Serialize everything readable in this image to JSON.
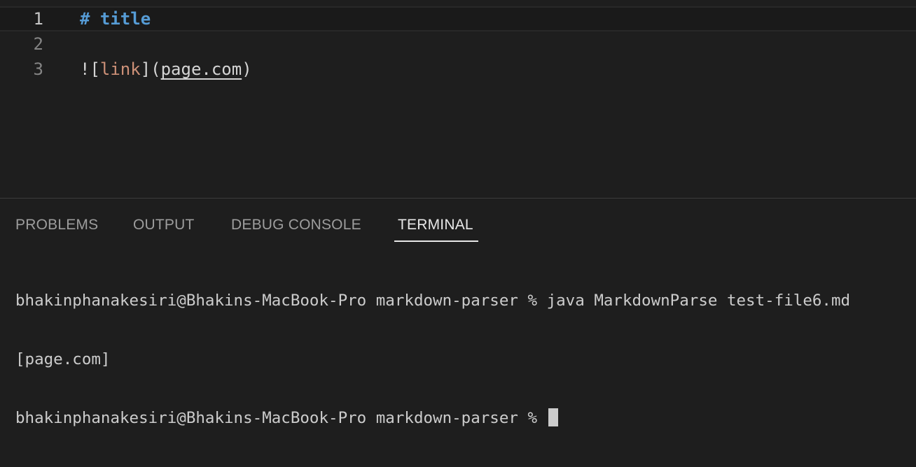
{
  "editor": {
    "lines": [
      {
        "number": "1",
        "parts": {
          "heading": "# title"
        }
      },
      {
        "number": "2"
      },
      {
        "number": "3",
        "parts": {
          "bang_open": "![",
          "link_text": "link",
          "bracket_paren": "](",
          "url": "page.com",
          "close": ")"
        }
      }
    ]
  },
  "panel": {
    "tabs": [
      {
        "label": "PROBLEMS"
      },
      {
        "label": "OUTPUT"
      },
      {
        "label": "DEBUG CONSOLE"
      },
      {
        "label": "TERMINAL",
        "active": true
      }
    ],
    "terminal": {
      "lines": [
        "bhakinphanakesiri@Bhakins-MacBook-Pro markdown-parser % java MarkdownParse test-file6.md",
        "[page.com]",
        "bhakinphanakesiri@Bhakins-MacBook-Pro markdown-parser % "
      ]
    }
  },
  "colors": {
    "background": "#1e1e1e",
    "heading": "#569cd6",
    "link_text": "#ce9178",
    "line_number": "#858585",
    "active_tab": "#e7e7e7",
    "inactive_tab": "#9d9d9d"
  }
}
